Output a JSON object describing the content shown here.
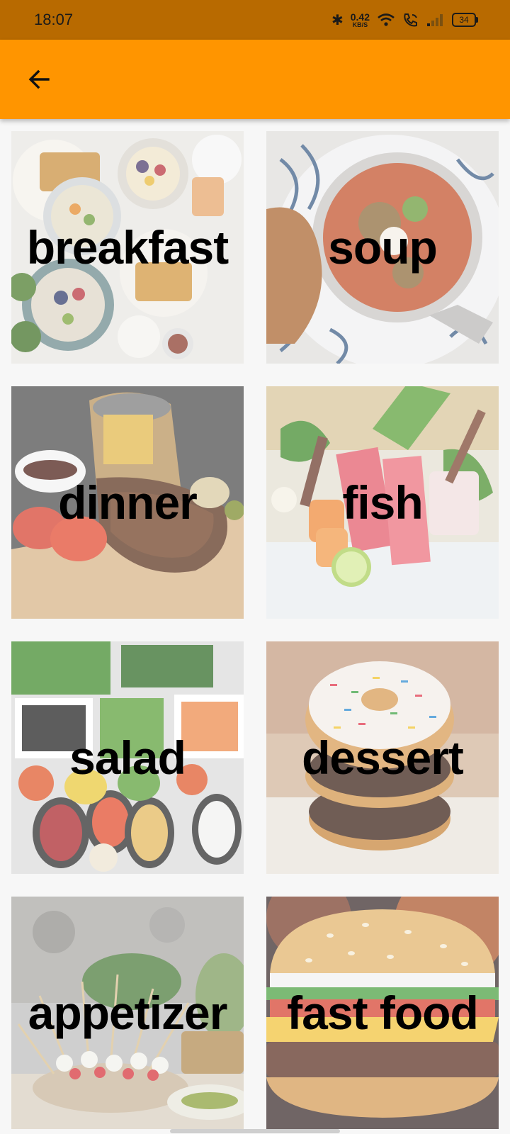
{
  "status_bar": {
    "time": "18:07",
    "net_speed_value": "0.42",
    "net_speed_unit": "KB/S",
    "battery": "34"
  },
  "app_bar": {
    "back_icon": "arrow-left-icon",
    "background": "#ff9500"
  },
  "categories": [
    {
      "label": "breakfast"
    },
    {
      "label": "soup"
    },
    {
      "label": "dinner"
    },
    {
      "label": "fish"
    },
    {
      "label": "salad"
    },
    {
      "label": "dessert"
    },
    {
      "label": "appetizer"
    },
    {
      "label": "fast food"
    }
  ],
  "colors": {
    "status_bar": "#b86a00",
    "accent": "#ff9500",
    "background": "#f7f7f7"
  }
}
